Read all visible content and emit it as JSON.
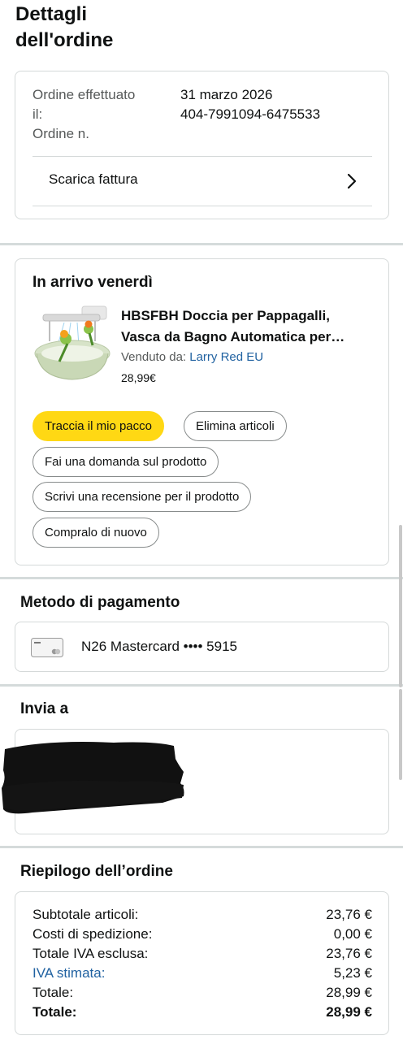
{
  "page": {
    "title_line1": "Dettagli",
    "title_line2": "dell'ordine"
  },
  "order_info": {
    "placed_label_line1": "Ordine effettuato",
    "placed_label_line2": "il:",
    "number_label": "Ordine n.",
    "placed_date": "31 marzo 2026",
    "order_number": "404-7991094-6475533",
    "invoice_link": "Scarica fattura",
    "invoice_chevron": "›"
  },
  "arrival": {
    "heading": "In arrivo venerdì",
    "product_title_line1": "HBSFBH Doccia per Pappagalli,",
    "product_title_line2": "Vasca da Bagno Automatica per…",
    "sold_by_label": "Venduto da:",
    "seller": "Larry Red EU",
    "price": "28,99€",
    "product_image_icon": "parrot-bath-product-image",
    "buttons": {
      "track": "Traccia il mio pacco",
      "delete": "Elimina articoli",
      "ask": "Fai una domanda sul prodotto",
      "review": "Scrivi una recensione per il prodotto",
      "buy_again": "Compralo di nuovo"
    }
  },
  "payment": {
    "heading": "Metodo di pagamento",
    "card_text": "N26 Mastercard •••• 5915",
    "card_icon": "credit-card-icon"
  },
  "ship_to": {
    "heading": "Invia a",
    "address_redacted": true
  },
  "summary": {
    "heading": "Riepilogo dell’ordine",
    "rows": [
      {
        "label": "Subtotale articoli:",
        "value": "23,76 €"
      },
      {
        "label": "Costi di spedizione:",
        "value": "0,00 €"
      },
      {
        "label": "Totale IVA esclusa:",
        "value": "23,76 €"
      },
      {
        "label": "IVA stimata:",
        "value": "5,23 €"
      },
      {
        "label": "Totale:",
        "value": "28,99 €"
      },
      {
        "label": "Totale:",
        "value": "28,99 €"
      }
    ]
  },
  "colors": {
    "primary_button": "#ffd814",
    "link_blue": "#2162a1",
    "border": "#d5d9d9",
    "muted_text": "#565959"
  }
}
